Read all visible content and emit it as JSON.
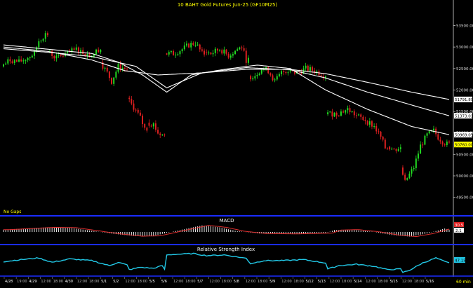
{
  "colors": {
    "background": "#000000",
    "up_candle": "#22dd22",
    "down_candle": "#e02020",
    "moving_average": "#ffffff",
    "title_text": "#ffff00",
    "panel_divider": "#1a2cff",
    "rsi_line": "#22c8e6",
    "macd_signal": "#e03030",
    "macd_hist": "#ffffff",
    "last_price_tag": "#ffff00",
    "ma_tag": "#ffffff"
  },
  "chart_data": [
    {
      "type": "candlestick",
      "title": "10  BAHT  Gold  Futures  Jun-25  (GF10M25)",
      "note": "No Gaps",
      "ylim": [
        49200,
        53900
      ],
      "yticks": [
        49500,
        50000,
        50500,
        51000,
        51500,
        52000,
        52500,
        53000,
        53500
      ],
      "ytick_labels": [
        "49500.00",
        "50000.00",
        "50500.00",
        "51000.00",
        "51500.00",
        "52000.00",
        "52500.00",
        "53000.00",
        "53500.00"
      ],
      "price_tags": [
        {
          "label": "51791.89",
          "value": 51780,
          "kind": "ma"
        },
        {
          "label": "51373.01",
          "value": 51400,
          "kind": "ma"
        },
        {
          "label": "50969.05",
          "value": 50960,
          "kind": "ma"
        },
        {
          "label": "50760.00",
          "value": 50730,
          "kind": "last"
        }
      ],
      "x_axis_labels": [
        "4/28",
        "19:00",
        "4/29",
        "12:00",
        "18:00",
        "4/30",
        "12:00",
        "18:00",
        "5/1",
        "5/2",
        "12:00",
        "18:00",
        "5/5",
        "5/6",
        "12:00",
        "18:00",
        "5/7",
        "12:00",
        "18:00",
        "5/8",
        "12:00",
        "18:00",
        "5/9",
        "12:00",
        "18:00",
        "5/12",
        "5/13",
        "12:00",
        "18:00",
        "5/14",
        "12:00",
        "18:00",
        "5/15",
        "12:00",
        "18:00",
        "5/16"
      ],
      "x_axis_period": "60  min",
      "segments": [
        {
          "t0": 0,
          "t1": 20,
          "keys": [
            [
              0,
              52550
            ],
            [
              4,
              52700
            ],
            [
              8,
              52650
            ],
            [
              12,
              52750
            ],
            [
              15,
              52850
            ],
            [
              17,
              53150
            ],
            [
              19,
              53250
            ],
            [
              20,
              53300
            ]
          ]
        },
        {
          "t0": 21,
          "t1": 44,
          "keys": [
            [
              21,
              52900
            ],
            [
              25,
              52750
            ],
            [
              30,
              52850
            ],
            [
              34,
              52950
            ],
            [
              38,
              52850
            ],
            [
              41,
              52800
            ],
            [
              44,
              52950
            ]
          ]
        },
        {
          "t0": 45,
          "t1": 56,
          "keys": [
            [
              45,
              52650
            ],
            [
              48,
              52400
            ],
            [
              50,
              52200
            ],
            [
              53,
              52550
            ],
            [
              56,
              52500
            ]
          ]
        },
        {
          "t0": 57,
          "t1": 65,
          "keys": [
            [
              57,
              51800
            ],
            [
              60,
              51600
            ],
            [
              63,
              51350
            ],
            [
              65,
              51100
            ]
          ]
        },
        {
          "t0": 66,
          "t1": 73,
          "keys": [
            [
              66,
              51250
            ],
            [
              69,
              51200
            ],
            [
              71,
              51000
            ],
            [
              73,
              50950
            ]
          ]
        },
        {
          "t0": 74,
          "t1": 91,
          "keys": [
            [
              74,
              52850
            ],
            [
              78,
              52850
            ],
            [
              82,
              52950
            ],
            [
              85,
              53050
            ],
            [
              88,
              53100
            ],
            [
              91,
              52850
            ]
          ]
        },
        {
          "t0": 92,
          "t1": 111,
          "keys": [
            [
              92,
              52900
            ],
            [
              95,
              52850
            ],
            [
              99,
              52950
            ],
            [
              103,
              52800
            ],
            [
              107,
              52950
            ],
            [
              109,
              53000
            ],
            [
              111,
              52700
            ]
          ]
        },
        {
          "t0": 112,
          "t1": 129,
          "keys": [
            [
              112,
              52300
            ],
            [
              115,
              52350
            ],
            [
              118,
              52500
            ],
            [
              121,
              52450
            ],
            [
              124,
              52200
            ],
            [
              127,
              52400
            ],
            [
              129,
              52450
            ]
          ]
        },
        {
          "t0": 130,
          "t1": 146,
          "keys": [
            [
              130,
              52450
            ],
            [
              134,
              52400
            ],
            [
              138,
              52500
            ],
            [
              142,
              52450
            ],
            [
              146,
              52350
            ]
          ]
        },
        {
          "t0": 147,
          "t1": 174,
          "keys": [
            [
              147,
              51450
            ],
            [
              152,
              51450
            ],
            [
              157,
              51550
            ],
            [
              161,
              51400
            ],
            [
              165,
              51300
            ],
            [
              169,
              51150
            ],
            [
              172,
              50900
            ],
            [
              174,
              50650
            ]
          ]
        },
        {
          "t0": 175,
          "t1": 180,
          "keys": [
            [
              175,
              50700
            ],
            [
              178,
              50600
            ],
            [
              180,
              50650
            ]
          ]
        },
        {
          "t0": 181,
          "t1": 202,
          "keys": [
            [
              181,
              50200
            ],
            [
              183,
              49850
            ],
            [
              184,
              49950
            ],
            [
              187,
              50200
            ],
            [
              190,
              50700
            ],
            [
              193,
              50950
            ],
            [
              196,
              51050
            ],
            [
              198,
              50900
            ],
            [
              200,
              50800
            ],
            [
              202,
              50740
            ]
          ]
        }
      ],
      "moving_averages": [
        {
          "keys": [
            [
              0,
              52960
            ],
            [
              20,
              52880
            ],
            [
              40,
              52780
            ],
            [
              60,
              52550
            ],
            [
              74,
              52050
            ],
            [
              90,
              52400
            ],
            [
              110,
              52480
            ],
            [
              130,
              52480
            ],
            [
              146,
              52380
            ],
            [
              165,
              52180
            ],
            [
              185,
              51950
            ],
            [
              202,
              51780
            ]
          ]
        },
        {
          "keys": [
            [
              0,
              53000
            ],
            [
              20,
              52900
            ],
            [
              40,
              52700
            ],
            [
              55,
              52450
            ],
            [
              70,
              52350
            ],
            [
              90,
              52400
            ],
            [
              110,
              52520
            ],
            [
              130,
              52470
            ],
            [
              146,
              52280
            ],
            [
              165,
              51950
            ],
            [
              185,
              51650
            ],
            [
              202,
              51400
            ]
          ]
        },
        {
          "keys": [
            [
              0,
              53050
            ],
            [
              20,
              52950
            ],
            [
              40,
              52850
            ],
            [
              52,
              52650
            ],
            [
              63,
              52350
            ],
            [
              74,
              51950
            ],
            [
              85,
              52350
            ],
            [
              100,
              52480
            ],
            [
              115,
              52580
            ],
            [
              130,
              52500
            ],
            [
              146,
              52000
            ],
            [
              165,
              51550
            ],
            [
              185,
              51150
            ],
            [
              202,
              50960
            ]
          ]
        }
      ]
    },
    {
      "type": "bar",
      "title": "MACD",
      "series": [
        {
          "name": "MACD"
        }
      ],
      "value_tags": [
        "30.5",
        "2.1"
      ],
      "keys": [
        [
          0,
          0.3
        ],
        [
          10,
          0.45
        ],
        [
          20,
          0.6
        ],
        [
          30,
          0.55
        ],
        [
          40,
          0.15
        ],
        [
          50,
          -0.25
        ],
        [
          60,
          -0.55
        ],
        [
          68,
          -0.5
        ],
        [
          76,
          0.0
        ],
        [
          84,
          0.5
        ],
        [
          90,
          0.85
        ],
        [
          98,
          0.6
        ],
        [
          106,
          0.1
        ],
        [
          116,
          -0.2
        ],
        [
          130,
          -0.25
        ],
        [
          146,
          -0.15
        ],
        [
          150,
          0.25
        ],
        [
          158,
          0.3
        ],
        [
          168,
          0.0
        ],
        [
          176,
          -0.4
        ],
        [
          184,
          -0.6
        ],
        [
          192,
          -0.2
        ],
        [
          200,
          0.45
        ],
        [
          202,
          0.3
        ]
      ]
    },
    {
      "type": "line",
      "title": "Relative  Strength  Index",
      "series": [
        {
          "name": "Relative  Strength  Index"
        }
      ],
      "value_tag": "47.15",
      "keys": [
        [
          0,
          52
        ],
        [
          8,
          58
        ],
        [
          16,
          63
        ],
        [
          22,
          50
        ],
        [
          30,
          60
        ],
        [
          40,
          55
        ],
        [
          48,
          40
        ],
        [
          52,
          50
        ],
        [
          56,
          42
        ],
        [
          57,
          28
        ],
        [
          62,
          35
        ],
        [
          68,
          32
        ],
        [
          72,
          40
        ],
        [
          73,
          28
        ],
        [
          74,
          72
        ],
        [
          78,
          74
        ],
        [
          86,
          76
        ],
        [
          92,
          70
        ],
        [
          100,
          72
        ],
        [
          110,
          62
        ],
        [
          112,
          46
        ],
        [
          118,
          55
        ],
        [
          126,
          55
        ],
        [
          136,
          58
        ],
        [
          146,
          48
        ],
        [
          147,
          30
        ],
        [
          152,
          40
        ],
        [
          160,
          44
        ],
        [
          168,
          38
        ],
        [
          174,
          28
        ],
        [
          180,
          30
        ],
        [
          181,
          20
        ],
        [
          184,
          26
        ],
        [
          190,
          48
        ],
        [
          196,
          63
        ],
        [
          200,
          52
        ],
        [
          202,
          48
        ]
      ]
    }
  ]
}
